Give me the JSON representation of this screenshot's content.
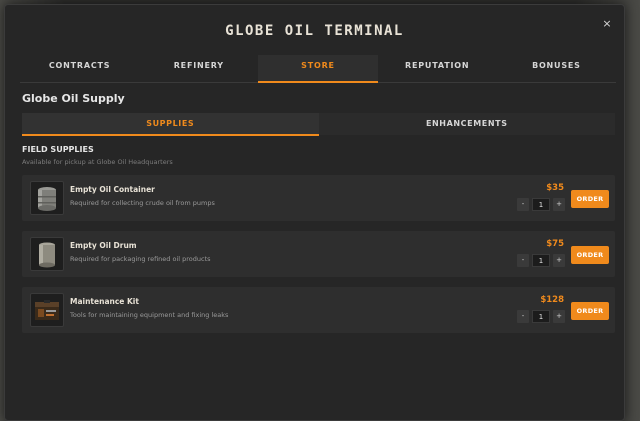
{
  "window": {
    "title": "GLOBE OIL TERMINAL",
    "close_glyph": "×"
  },
  "main_tabs": [
    {
      "label": "CONTRACTS",
      "active": false
    },
    {
      "label": "REFINERY",
      "active": false
    },
    {
      "label": "STORE",
      "active": true
    },
    {
      "label": "REPUTATION",
      "active": false
    },
    {
      "label": "BONUSES",
      "active": false
    }
  ],
  "section": {
    "title": "Globe Oil Supply"
  },
  "sub_tabs": [
    {
      "label": "SUPPLIES",
      "active": true
    },
    {
      "label": "ENHANCEMENTS",
      "active": false
    }
  ],
  "field": {
    "heading": "FIELD SUPPLIES",
    "subheading": "Available for pickup at Globe Oil Headquarters"
  },
  "items": [
    {
      "name": "Empty Oil Container",
      "description": "Required for collecting crude oil from pumps",
      "price": "$35",
      "quantity": "1",
      "minus": "-",
      "plus": "+",
      "order_label": "ORDER",
      "icon": "oil-container-icon"
    },
    {
      "name": "Empty Oil Drum",
      "description": "Required for packaging refined oil products",
      "price": "$75",
      "quantity": "1",
      "minus": "-",
      "plus": "+",
      "order_label": "ORDER",
      "icon": "oil-drum-icon"
    },
    {
      "name": "Maintenance Kit",
      "description": "Tools for maintaining equipment and fixing leaks",
      "price": "$128",
      "quantity": "1",
      "minus": "-",
      "plus": "+",
      "order_label": "ORDER",
      "icon": "maintenance-kit-icon"
    }
  ],
  "colors": {
    "accent": "#f08a1c",
    "panel": "#262626",
    "row": "#2e2e2e"
  }
}
